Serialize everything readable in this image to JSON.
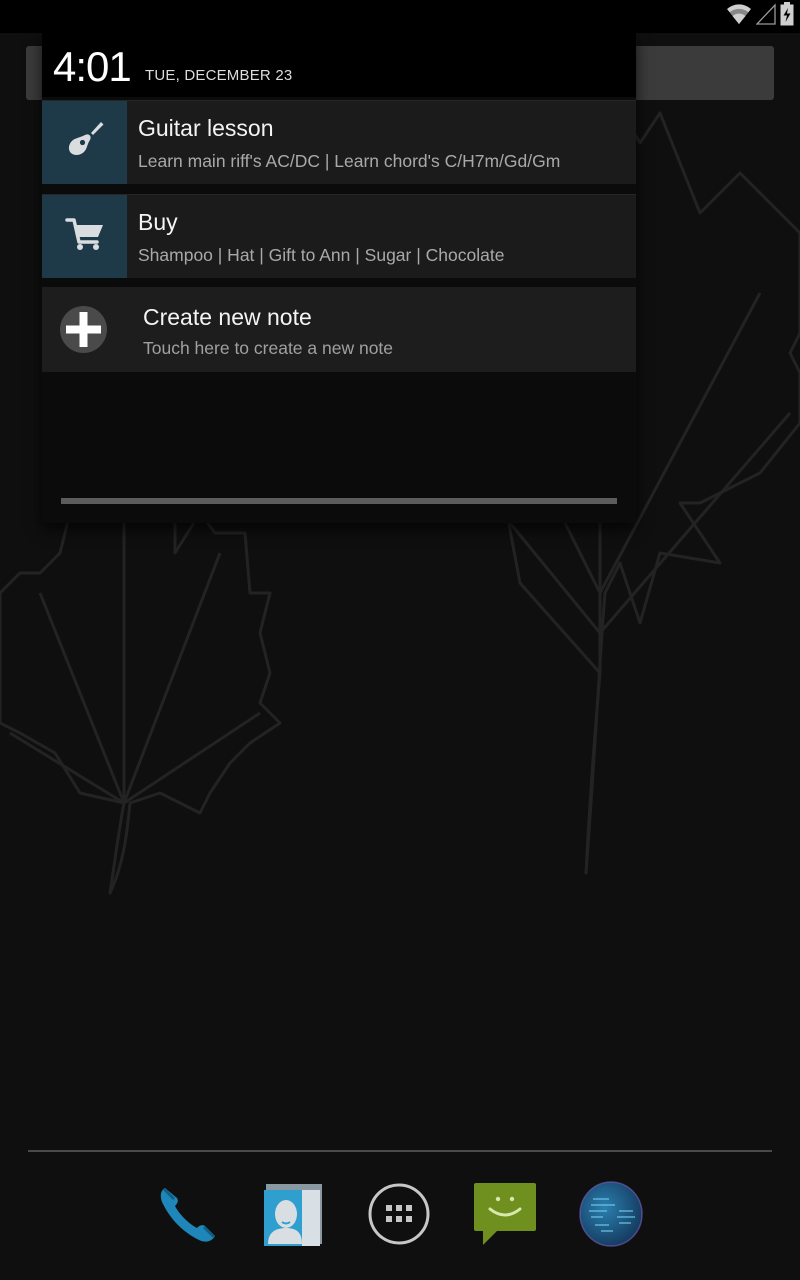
{
  "status_bar": {
    "icons": [
      "wifi-icon",
      "cell-signal-icon",
      "battery-charging-icon"
    ]
  },
  "widget": {
    "time": "4:01",
    "date": "TUE, DECEMBER 23",
    "notes": [
      {
        "icon": "guitar-icon",
        "title": "Guitar lesson",
        "subtitle": "Learn main riff's AC/DC | Learn chord's C/H7m/Gd/Gm"
      },
      {
        "icon": "shopping-cart-icon",
        "title": "Buy",
        "subtitle": "Shampoo | Hat | Gift to Ann | Sugar | Chocolate"
      }
    ],
    "create_note": {
      "icon": "plus-icon",
      "title": "Create new note",
      "subtitle": "Touch here to create a new note"
    },
    "accent_color": "#1e3a48"
  },
  "dock": {
    "items": [
      {
        "name": "Phone",
        "icon": "phone-icon"
      },
      {
        "name": "Contacts",
        "icon": "contacts-icon"
      },
      {
        "name": "All apps",
        "icon": "app-drawer-icon"
      },
      {
        "name": "Messaging",
        "icon": "messaging-icon"
      },
      {
        "name": "Browser",
        "icon": "browser-globe-icon"
      }
    ]
  }
}
